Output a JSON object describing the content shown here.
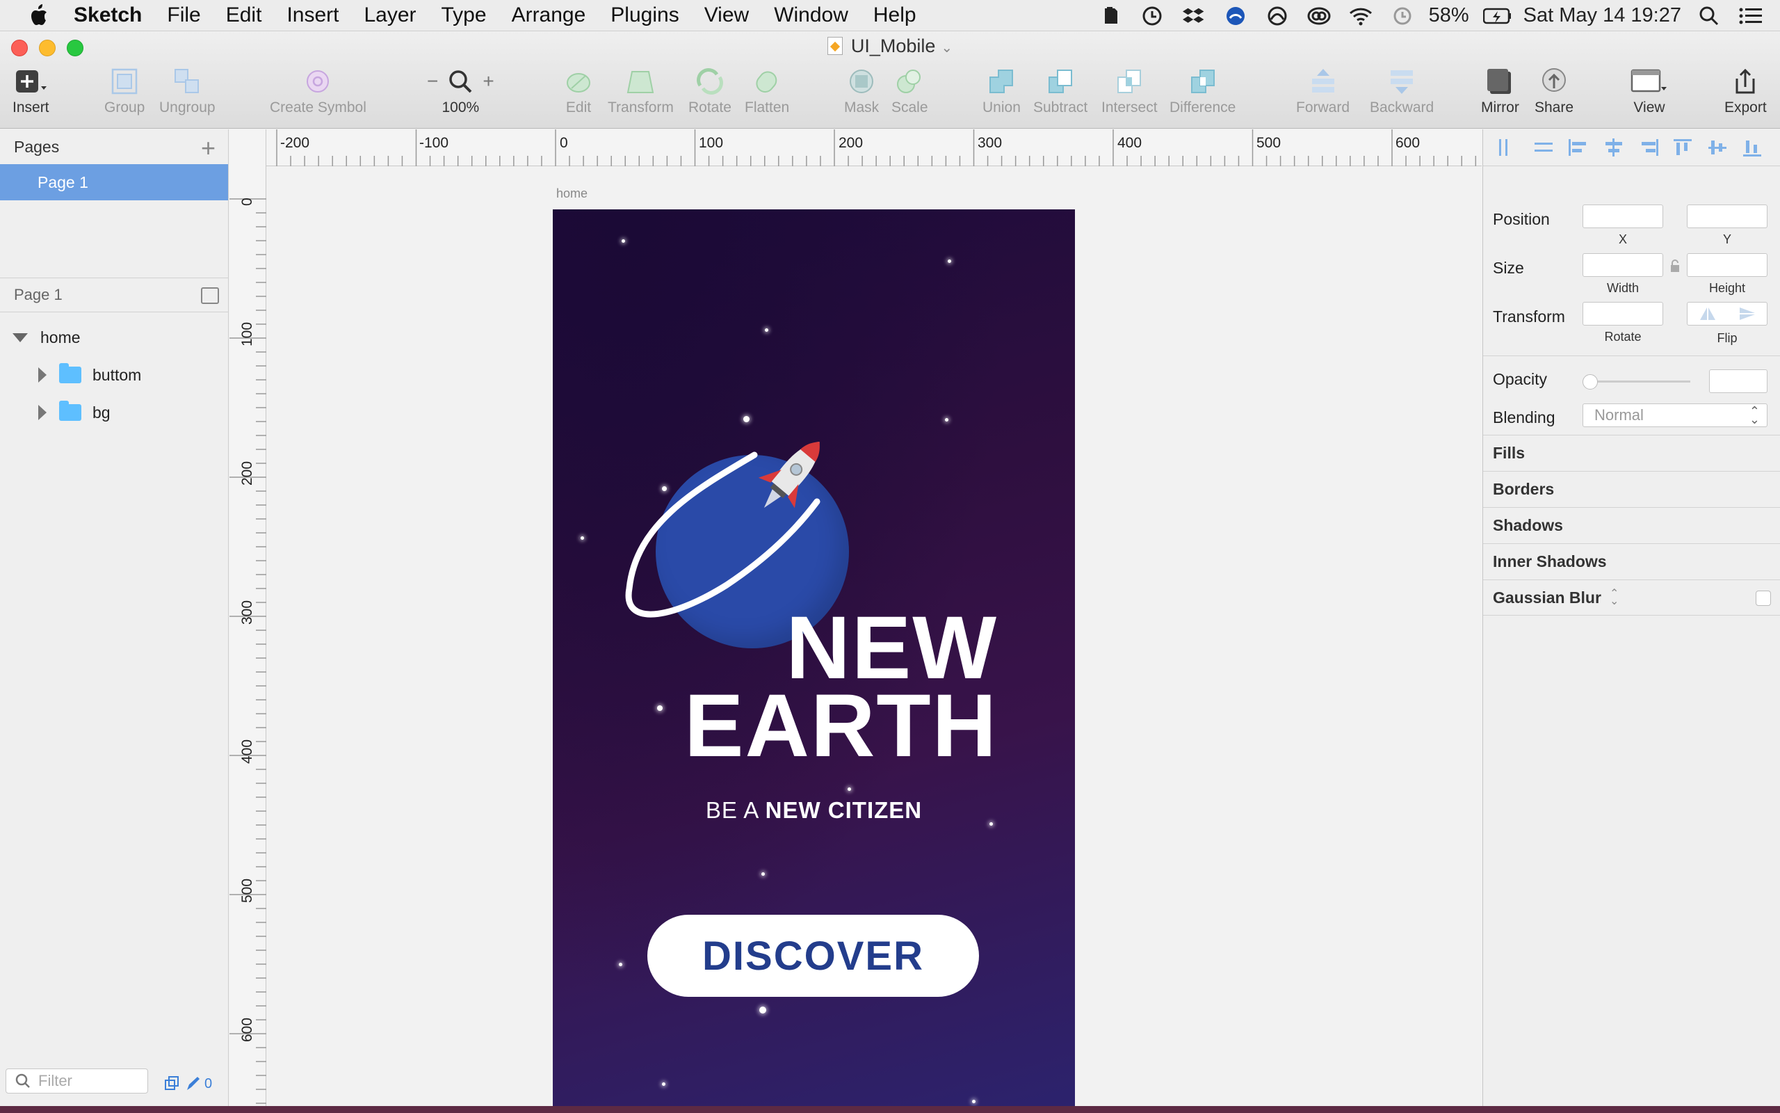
{
  "menubar": {
    "items": [
      "Sketch",
      "File",
      "Edit",
      "Insert",
      "Layer",
      "Type",
      "Arrange",
      "Plugins",
      "View",
      "Window",
      "Help"
    ],
    "battery": "58%",
    "datetime": "Sat May 14  19:27"
  },
  "window": {
    "title": "UI_Mobile"
  },
  "toolbar": {
    "insert": "Insert",
    "group": "Group",
    "ungroup": "Ungroup",
    "create_symbol": "Create Symbol",
    "zoom": "100%",
    "edit": "Edit",
    "transform": "Transform",
    "rotate": "Rotate",
    "flatten": "Flatten",
    "mask": "Mask",
    "scale": "Scale",
    "union": "Union",
    "subtract": "Subtract",
    "intersect": "Intersect",
    "difference": "Difference",
    "forward": "Forward",
    "backward": "Backward",
    "mirror": "Mirror",
    "share": "Share",
    "view": "View",
    "export": "Export"
  },
  "pages": {
    "header": "Pages",
    "items": [
      "Page 1"
    ]
  },
  "layers": {
    "header": "Page 1",
    "root": "home",
    "children": [
      "buttom",
      "bg"
    ],
    "filter_placeholder": "Filter",
    "count": "0"
  },
  "rulers": {
    "h": [
      "-200",
      "-100",
      "0",
      "100",
      "200",
      "300",
      "400",
      "500",
      "600"
    ],
    "v": [
      "0",
      "100",
      "200",
      "300",
      "400",
      "500",
      "600"
    ]
  },
  "artboard": {
    "label": "home",
    "headline_1": "NEW",
    "headline_2": "EARTH",
    "sub_prefix": "BE A ",
    "sub_bold": "NEW CITIZEN",
    "button": "DISCOVER",
    "colors": {
      "planet": "#2a4aa8",
      "button_text": "#233d8c",
      "bg_top": "#1d0b3a",
      "bg_bottom": "#2b2470"
    }
  },
  "inspector": {
    "position": "Position",
    "x": "X",
    "y": "Y",
    "size": "Size",
    "width": "Width",
    "height": "Height",
    "transform": "Transform",
    "rotate": "Rotate",
    "flip": "Flip",
    "opacity": "Opacity",
    "blending": "Blending",
    "blending_value": "Normal",
    "sections": [
      "Fills",
      "Borders",
      "Shadows",
      "Inner Shadows",
      "Gaussian Blur"
    ]
  }
}
